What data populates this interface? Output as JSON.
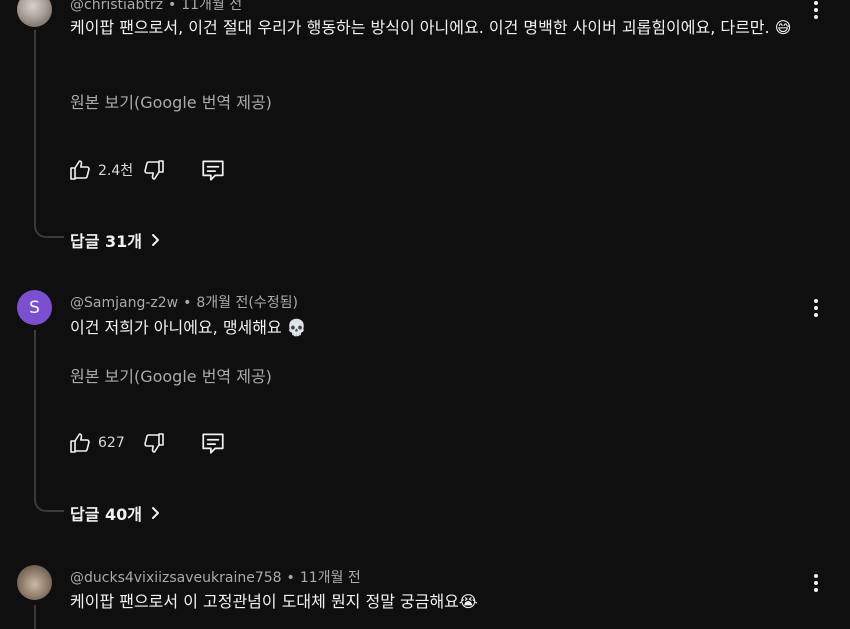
{
  "comments": [
    {
      "author": "@christiabtrz",
      "time": "11개월 전",
      "text": "케이팝 팬으로서, 이건 절대 우리가 행동하는 방식이 아니에요. 이건 명백한 사이버 괴롭힘이에요, 다르만. 😅",
      "translate": "원본 보기(Google 번역 제공)",
      "likes": "2.4천",
      "replies": "답글 31개"
    },
    {
      "author": "@Samjang-z2w",
      "time": "8개월 전(수정됨)",
      "avatar_letter": "S",
      "avatar_color": "#7a4fd0",
      "text": "이건 저희가 아니에요, 맹세해요 💀",
      "translate": "원본 보기(Google 번역 제공)",
      "likes": "627",
      "replies": "답글 40개"
    },
    {
      "author": "@ducks4vixiizsaveukraine758",
      "time": "11개월 전",
      "text": "케이팝 팬으로서 이 고정관념이 도대체 뭔지 정말 궁금해요😭"
    }
  ],
  "icons": {
    "like": "thumbs-up-icon",
    "dislike": "thumbs-down-icon",
    "reply": "comment-reply-icon",
    "more": "vertical-dots-icon",
    "expand": "chevron-right-icon"
  },
  "colors": {
    "background": "#0f0f0f",
    "text": "#f1f1f1",
    "secondary_text": "#aaaaaa",
    "thread_line": "#3a3a3a"
  }
}
